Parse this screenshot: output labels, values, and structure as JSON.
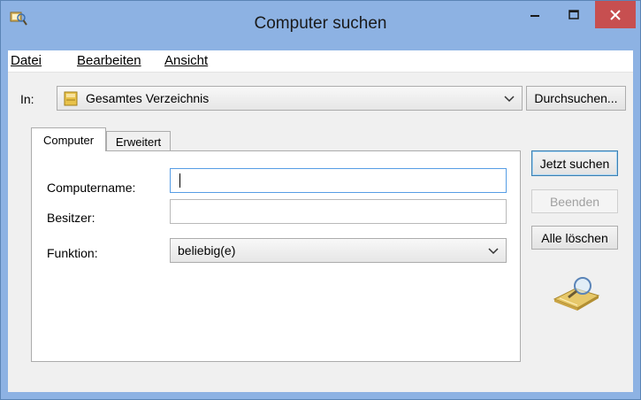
{
  "window": {
    "title": "Computer suchen",
    "minimize_glyph": "–",
    "maximize_glyph": "□",
    "close_glyph": "✕"
  },
  "menu": {
    "items": [
      {
        "label": "Datei"
      },
      {
        "label": "Bearbeiten"
      },
      {
        "label": "Ansicht"
      }
    ]
  },
  "location": {
    "label": "In:",
    "selected": "Gesamtes Verzeichnis",
    "browse_label": "Durchsuchen..."
  },
  "tabs": [
    {
      "label": "Computer",
      "active": true
    },
    {
      "label": "Erweitert",
      "active": false
    }
  ],
  "form": {
    "computername_label": "Computername:",
    "computername_value": "",
    "owner_label": "Besitzer:",
    "owner_value": "",
    "function_label": "Funktion:",
    "function_selected": "beliebig(e)"
  },
  "actions": {
    "search_label": "Jetzt suchen",
    "stop_label": "Beenden",
    "clear_label": "Alle löschen"
  },
  "icons": {
    "window": "search-computer-icon",
    "folder": "directory-icon",
    "search_animation": "magnifier-folder-icon"
  },
  "colors": {
    "titlebar": "#8db2e3",
    "close_button": "#c74f50",
    "focus_border": "#569de5"
  }
}
